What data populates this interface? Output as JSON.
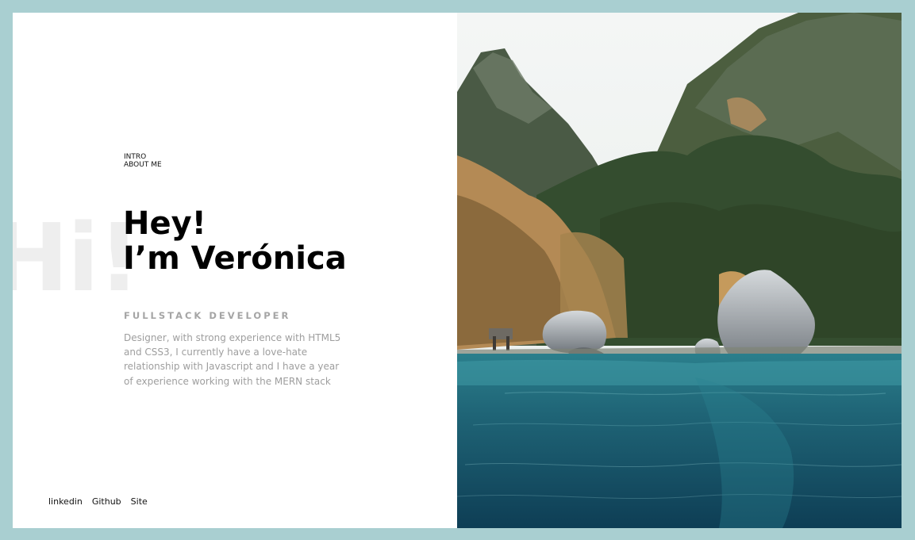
{
  "intro": {
    "section_tag": "INTRO ABOUT ME",
    "background_word": "Hi!",
    "headline_line1": "Hey!",
    "headline_line2": "I’m Verónica",
    "role": "FULLSTACK DEVELOPER",
    "description": "Designer, with strong experience with HTML5 and CSS3, I currently have a love-hate relationship with Javascript and I have a year of experience working with the MERN stack"
  },
  "footer_links": {
    "linkedin": "linkedin",
    "github": "Github",
    "site": "Site"
  },
  "colors": {
    "page_background": "#a9cfd1",
    "card_background": "#ffffff",
    "heading": "#000000",
    "muted_text": "#9e9e9e",
    "background_word": "#eeeeee"
  }
}
